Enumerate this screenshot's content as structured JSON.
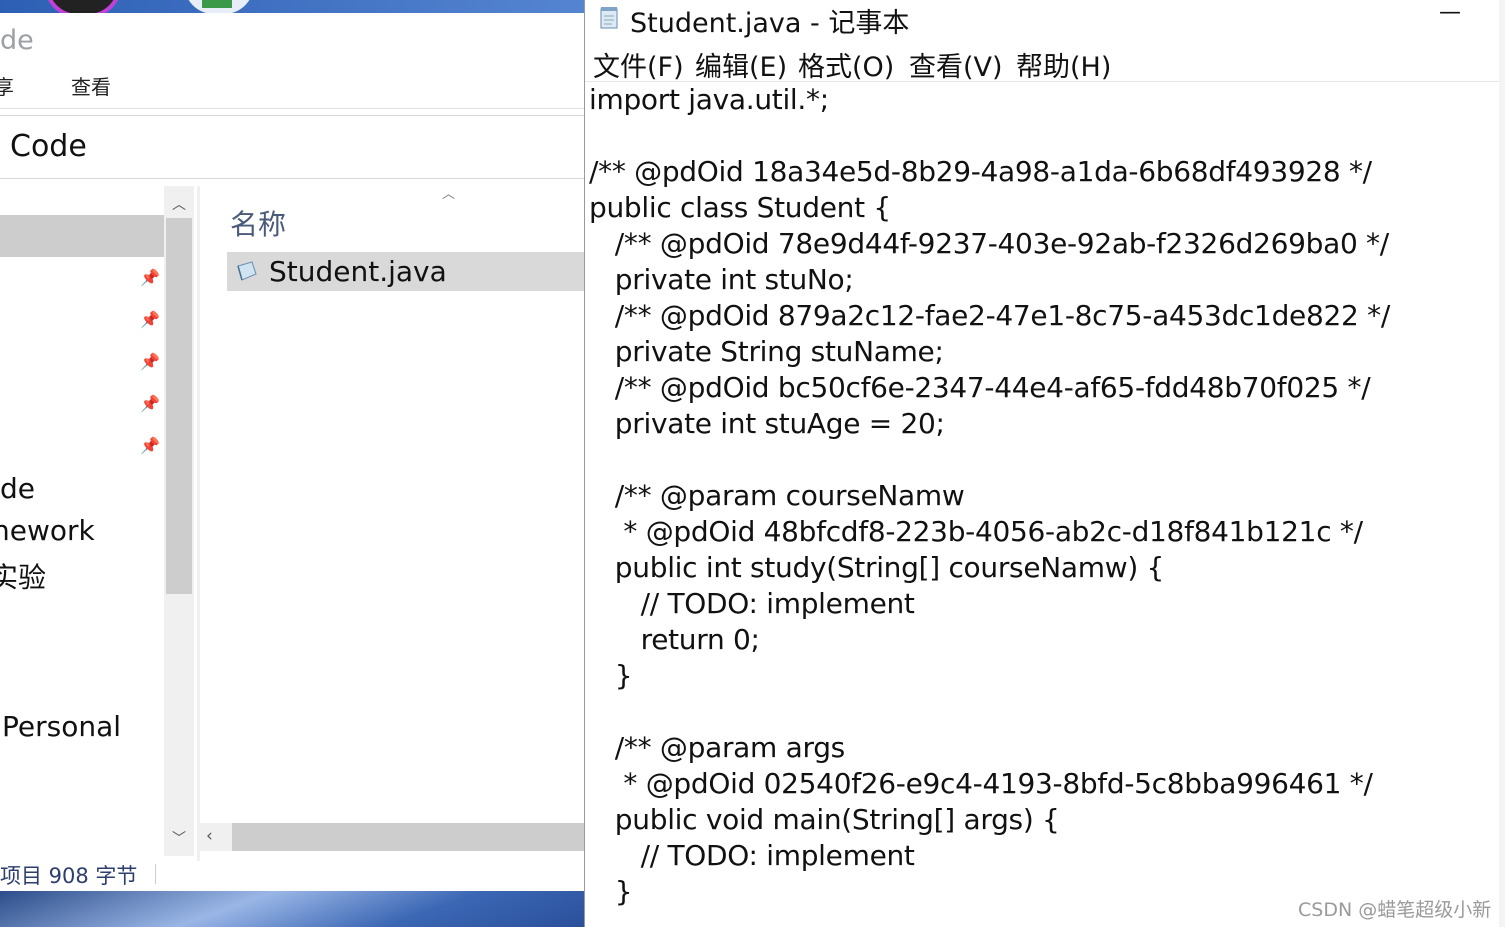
{
  "explorer": {
    "title_partial": "de",
    "menu": [
      "享",
      "查看"
    ],
    "address": "Code",
    "nav_items": [
      "de",
      "nework",
      "实验",
      "Personal"
    ],
    "column_name": "名称",
    "file": "Student.java",
    "status": "项目  908 字节"
  },
  "notepad": {
    "title": "Student.java - 记事本",
    "minimize": "—",
    "menu": [
      "文件(F)",
      "编辑(E)",
      "格式(O)",
      "查看(V)",
      "帮助(H)"
    ],
    "content": "import java.util.*;\n\n/** @pdOid 18a34e5d-8b29-4a98-a1da-6b68df493928 */\npublic class Student {\n   /** @pdOid 78e9d44f-9237-403e-92ab-f2326d269ba0 */\n   private int stuNo;\n   /** @pdOid 879a2c12-fae2-47e1-8c75-a453dc1de822 */\n   private String stuName;\n   /** @pdOid bc50cf6e-2347-44e4-af65-fdd48b70f025 */\n   private int stuAge = 20;\n   \n   /** @param courseNamw\n    * @pdOid 48bfcdf8-223b-4056-ab2c-d18f841b121c */\n   public int study(String[] courseNamw) {\n      // TODO: implement\n      return 0;\n   }\n   \n   /** @param args\n    * @pdOid 02540f26-e9c4-4193-8bfd-5c8bba996461 */\n   public void main(String[] args) {\n      // TODO: implement\n   }"
  },
  "watermark": "CSDN @蜡笔超级小新",
  "icons": {
    "pin": "pin-icon",
    "up": "chevron-up-icon",
    "down": "chevron-down-icon",
    "left": "chevron-left-icon",
    "sort": "sort-ascending-icon",
    "file": "java-file-icon",
    "notepad": "notepad-icon"
  }
}
